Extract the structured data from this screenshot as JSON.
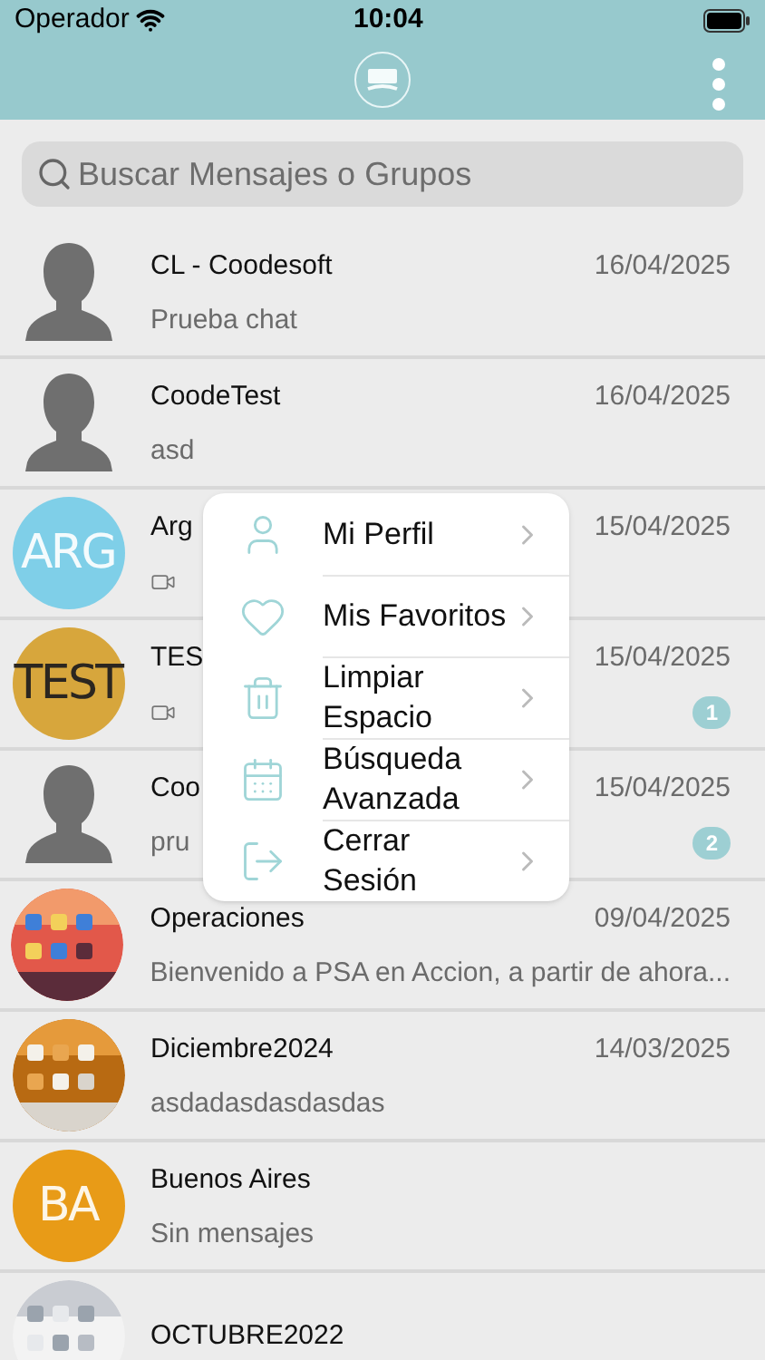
{
  "status_bar": {
    "carrier": "Operador",
    "time": "10:04"
  },
  "search": {
    "placeholder": "Buscar Mensajes o Grupos"
  },
  "chats": [
    {
      "kind": "text",
      "avatar": {
        "kind": "silhouette"
      },
      "name": "CL - Coodesoft",
      "date": "16/04/2025",
      "message": "Prueba chat"
    },
    {
      "kind": "text",
      "avatar": {
        "kind": "silhouette"
      },
      "name": "CoodeTest",
      "date": "16/04/2025",
      "message": "asd"
    },
    {
      "kind": "video",
      "avatar": {
        "kind": "initials",
        "text": "ARG",
        "color": "#7fcfe8"
      },
      "name": "Arg",
      "date": "15/04/2025"
    },
    {
      "kind": "video",
      "avatar": {
        "kind": "initials",
        "text": "TEST",
        "color": "#d7a63c"
      },
      "name": "TES",
      "date": "15/04/2025",
      "unread": "1"
    },
    {
      "kind": "text",
      "avatar": {
        "kind": "silhouette"
      },
      "name": "Coo",
      "date": "15/04/2025",
      "message": "pru",
      "unread": "2"
    },
    {
      "kind": "text",
      "name": "Operaciones",
      "date": "09/04/2025",
      "message": "Bienvenido a PSA en Accion, a partir de ahora..."
    },
    {
      "kind": "text",
      "name": "Diciembre2024",
      "date": "14/03/2025",
      "message": "asdadasdasdasdas"
    },
    {
      "kind": "text",
      "avatar": {
        "kind": "initials",
        "text": "BA",
        "color": "#e89b17"
      },
      "name": "Buenos Aires",
      "message": "Sin mensajes"
    },
    {
      "kind": "text",
      "name": "OCTUBRE2022"
    }
  ],
  "menu": [
    {
      "label": "Mi Perfil"
    },
    {
      "label": "Mis Favoritos"
    },
    {
      "label": "Limpiar Espacio"
    },
    {
      "label": "Búsqueda Avanzada"
    },
    {
      "label": "Cerrar Sesión"
    }
  ]
}
